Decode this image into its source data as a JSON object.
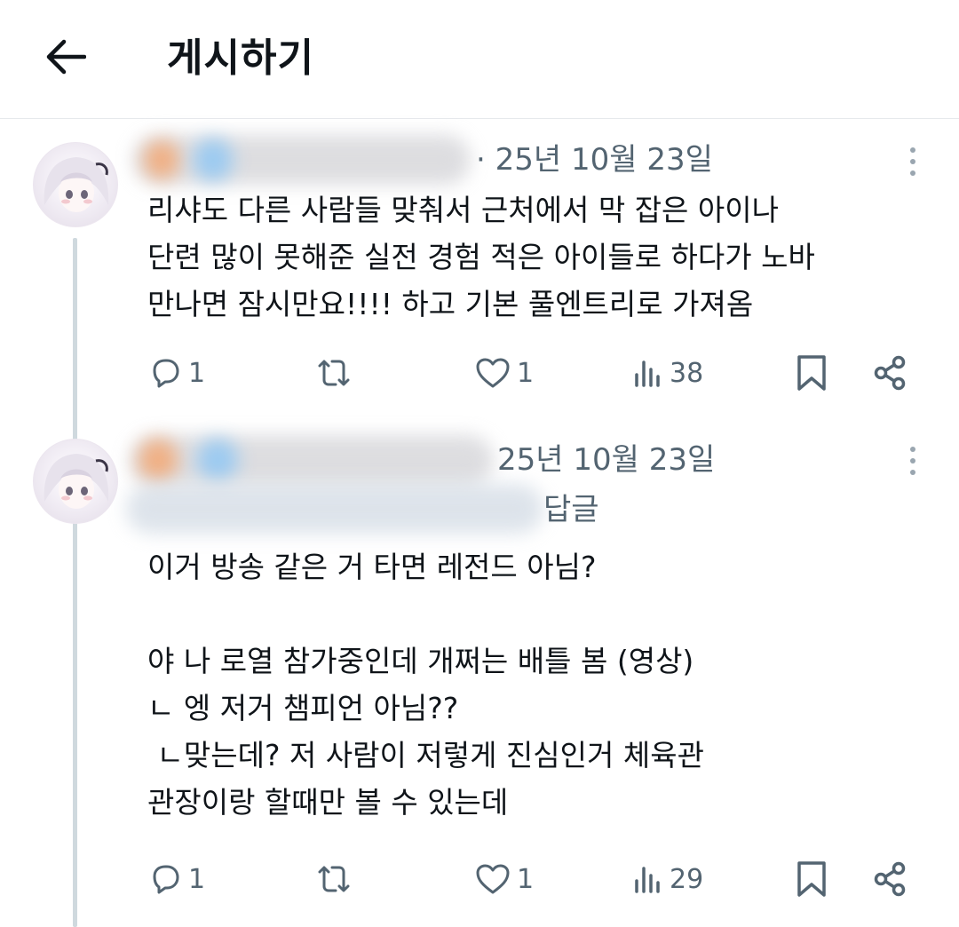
{
  "header": {
    "title": "게시하기",
    "back_icon": "arrow-left-icon"
  },
  "posts": [
    {
      "date": "· 25년 10월 23일",
      "body": "리샤도 다른 사람들 맞춰서 근처에서 막 잡은 아이나\n단련 많이 못해준 실전 경험 적은 아이들로 하다가 노바\n만나면 잠시만요!!!! 하고 기본 풀엔트리로 가져옴",
      "stats": {
        "replies": "1",
        "likes": "1",
        "views": "38"
      }
    },
    {
      "date": "25년 10월 23일",
      "reply_label": "답글",
      "body": "이거 방송 같은 거 타면 레전드 아님?\n\n야 나 로열 참가중인데 개쩌는 배틀 봄 (영상)\nㄴ 엥 저거 챔피언 아님??\n ㄴ맞는데? 저 사람이 저렇게 진심인거 체육관\n관장이랑 할때만 볼 수 있는데",
      "stats": {
        "replies": "1",
        "likes": "1",
        "views": "29"
      }
    }
  ],
  "icons": {
    "reply": "reply-icon",
    "repost": "repost-icon",
    "like": "heart-icon",
    "views": "views-icon",
    "bookmark": "bookmark-icon",
    "share": "share-icon",
    "more": "more-vertical-icon"
  },
  "colors": {
    "text": "#0f1419",
    "secondary": "#536471",
    "divider": "#e6e9ec",
    "thread_line": "#cfd9de"
  }
}
